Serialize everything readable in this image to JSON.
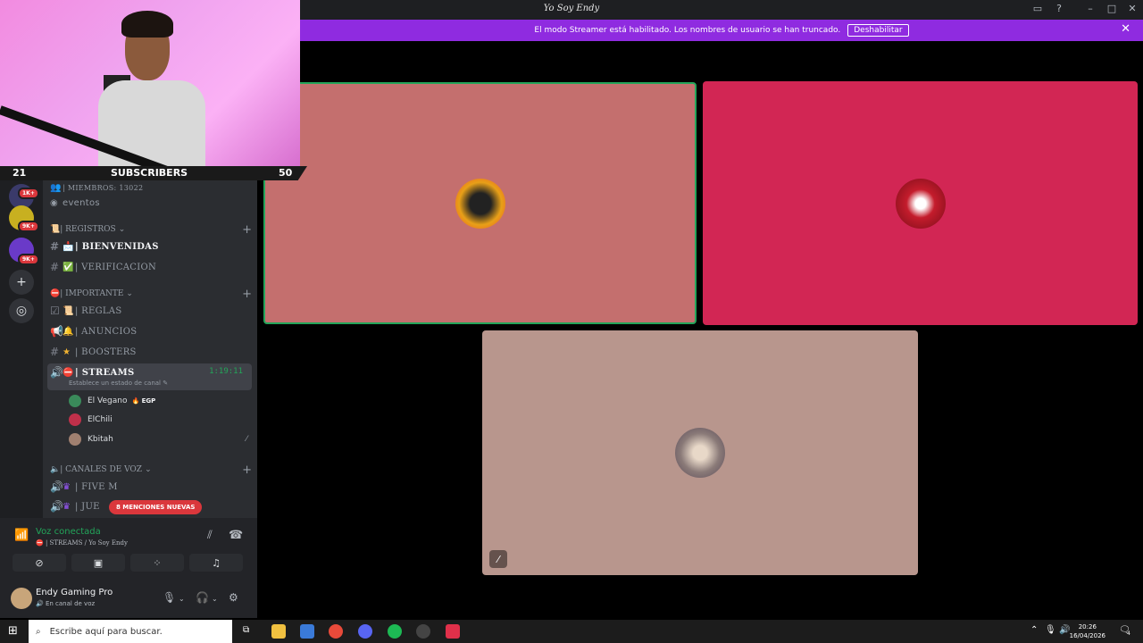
{
  "window": {
    "title": "Yo Soy Endy"
  },
  "streamer_banner": {
    "message": "El modo Streamer está habilitado. Los nombres de usuario se han truncado.",
    "button_label": "Deshabilitar"
  },
  "server_badges": [
    "1K+",
    "9K+",
    "9K+"
  ],
  "channels": {
    "members_label": "| MIEMBROS: 13022",
    "events_label": "eventos",
    "cat_registros": "| REGISTROS",
    "bienvenidas": "| BIENVENIDAS",
    "verificacion": "| VERIFICACION",
    "cat_importante": "| IMPORTANTE",
    "reglas": "| REGLAS",
    "anuncios": "| ANUNCIOS",
    "boosters": "| BOOSTERS",
    "streams": "| STREAMS",
    "streams_timer": "1:19:11",
    "streams_status": "Establece un estado de canal",
    "voice_users": [
      {
        "name": "El Vegano",
        "tag": "EGP",
        "color": "#3a8a5a"
      },
      {
        "name": "ElChili",
        "tag": "",
        "color": "#c0304a"
      },
      {
        "name": "Kbitah",
        "tag": "",
        "color": "#a08070"
      }
    ],
    "cat_voz": "| CANALES DE VOZ",
    "five_m": "| FIVE M",
    "juegos": "| JUE",
    "mentions_pill": "8 MENCIONES NUEVAS"
  },
  "voice_panel": {
    "status": "Voz conectada",
    "sub": "| STREAMS / Yo Soy Endy"
  },
  "user": {
    "name": "Endy Gaming Pro",
    "status": "En canal de voz"
  },
  "tiles": [
    {
      "name": "speaker-1",
      "bg": "#c46f6e",
      "avatar": "#e8a018"
    },
    {
      "name": "speaker-2",
      "bg": "#d22654",
      "avatar": "#c41c2c"
    },
    {
      "name": "speaker-3",
      "bg": "#b8968d",
      "avatar": "#8a7a78"
    }
  ],
  "overlay": {
    "left_count": "21",
    "label": "SUBSCRIBERS",
    "right_count": "50"
  },
  "taskbar": {
    "search_placeholder": "Escribe aquí para buscar.",
    "time": "20:26",
    "date": "16/04/2026",
    "notifications": "4"
  },
  "colors": {
    "accent": "#8f2be0",
    "connected": "#23a55a",
    "danger": "#da373c"
  }
}
